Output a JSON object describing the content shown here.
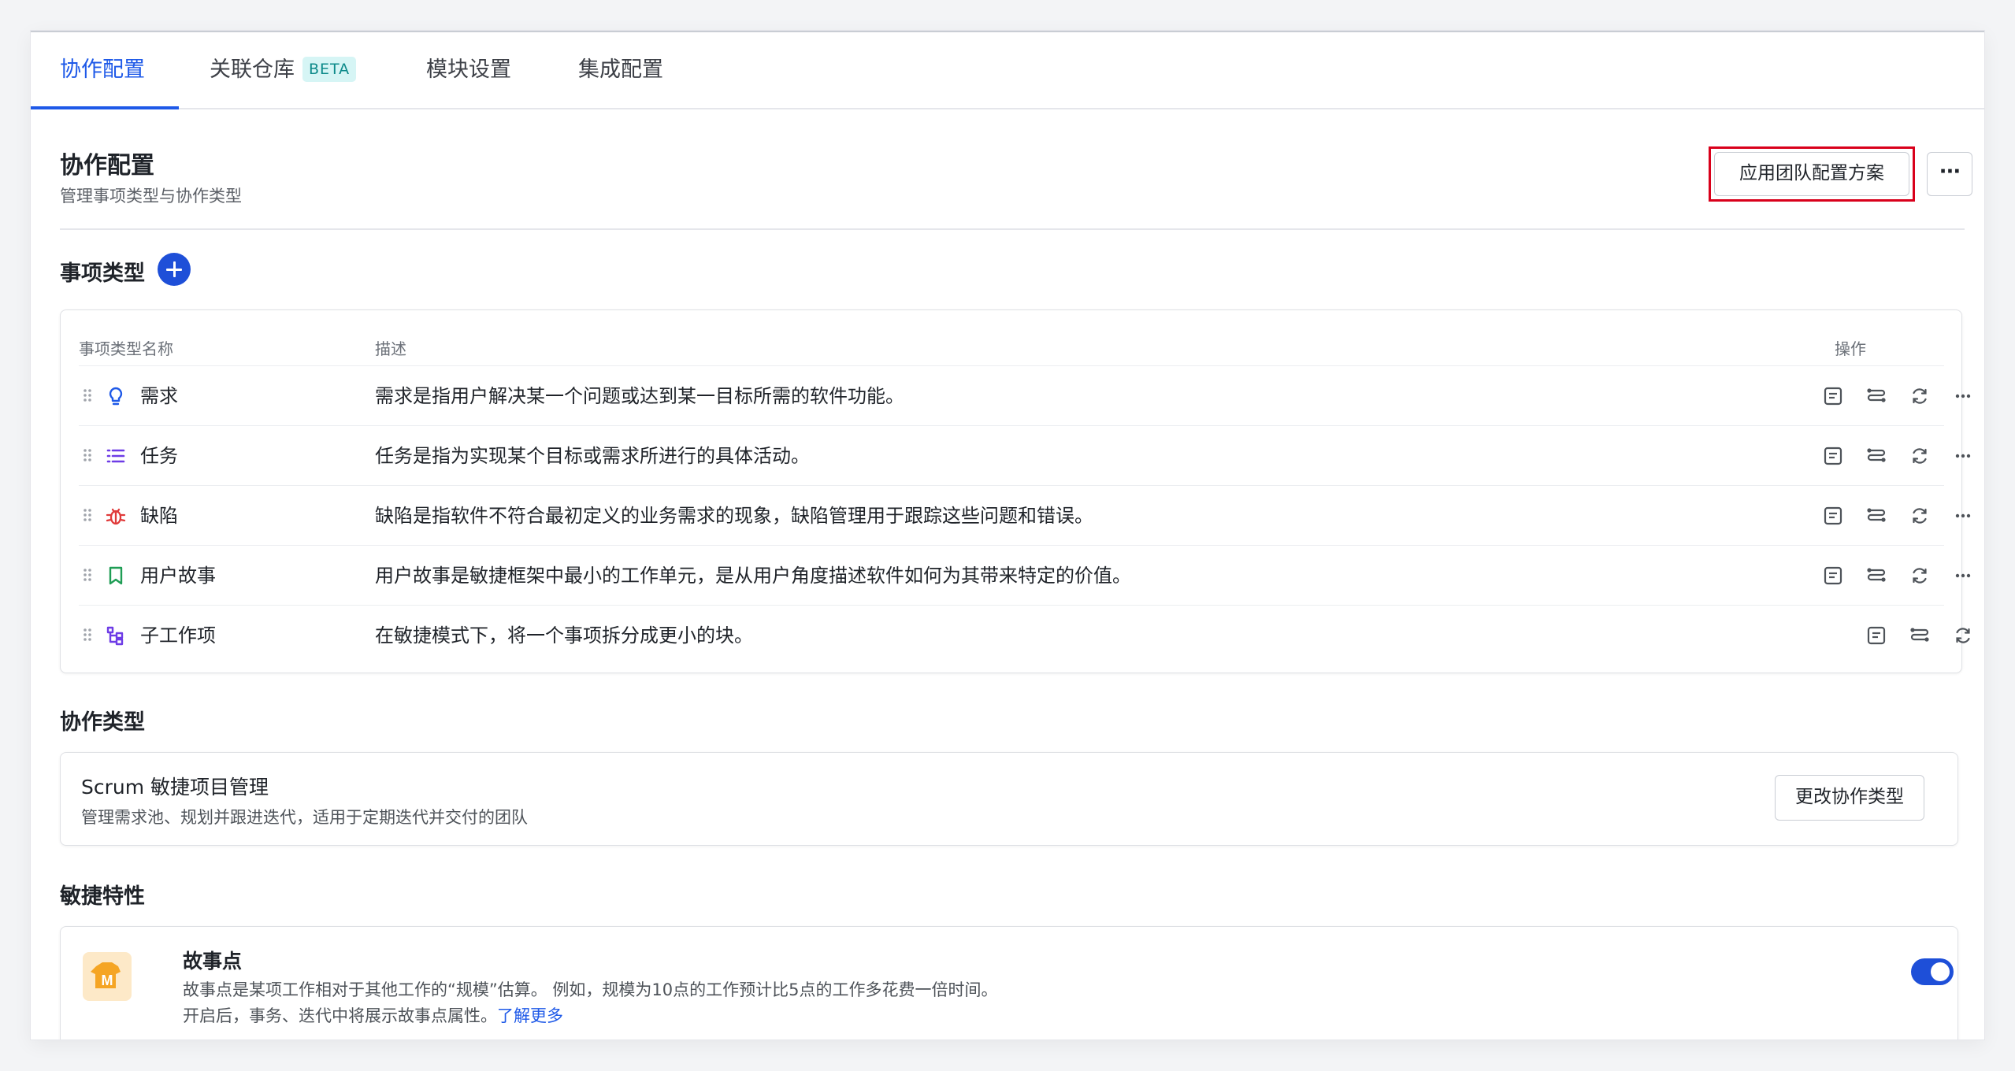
{
  "tabs": [
    {
      "label": "协作配置",
      "active": true
    },
    {
      "label": "关联仓库",
      "badge": "BETA"
    },
    {
      "label": "模块设置"
    },
    {
      "label": "集成配置"
    }
  ],
  "header": {
    "title": "协作配置",
    "subtitle": "管理事项类型与协作类型",
    "apply_button": "应用团队配置方案",
    "more_button": "···"
  },
  "issue_types": {
    "section_title": "事项类型",
    "columns": {
      "name": "事项类型名称",
      "desc": "描述",
      "actions": "操作"
    },
    "rows": [
      {
        "name": "需求",
        "icon": "lightbulb-icon",
        "color": "#1e59e8",
        "desc": "需求是指用户解决某一个问题或达到某一目标所需的软件功能。"
      },
      {
        "name": "任务",
        "icon": "list-icon",
        "color": "#6e3ce6",
        "desc": "任务是指为实现某个目标或需求所进行的具体活动。"
      },
      {
        "name": "缺陷",
        "icon": "bug-icon",
        "color": "#e03a3a",
        "desc": "缺陷是指软件不符合最初定义的业务需求的现象，缺陷管理用于跟踪这些问题和错误。"
      },
      {
        "name": "用户故事",
        "icon": "bookmark-icon",
        "color": "#1f9d55",
        "desc": "用户故事是敏捷框架中最小的工作单元，是从用户角度描述软件如何为其带来特定的价值。"
      },
      {
        "name": "子工作项",
        "icon": "subtask-icon",
        "color": "#6e3ce6",
        "desc": "在敏捷模式下，将一个事项拆分成更小的块。"
      }
    ]
  },
  "collab_type": {
    "section_title": "协作类型",
    "title": "Scrum 敏捷项目管理",
    "desc": "管理需求池、规划并跟进迭代，适用于定期迭代并交付的团队",
    "change_button": "更改协作类型"
  },
  "agile_features": {
    "section_title": "敏捷特性",
    "feature": {
      "title": "故事点",
      "desc1": "故事点是某项工作相对于其他工作的“规模”估算。 例如，规模为10点的工作预计比5点的工作多花费一倍时间。",
      "desc2_prefix": "开启后，事务、迭代中将展示故事点属性。",
      "link": "了解更多",
      "enabled": true,
      "icon_color": "#f08c1e"
    }
  },
  "colors": {
    "accent": "#1e59e8",
    "highlight_frame": "#d9001b"
  }
}
